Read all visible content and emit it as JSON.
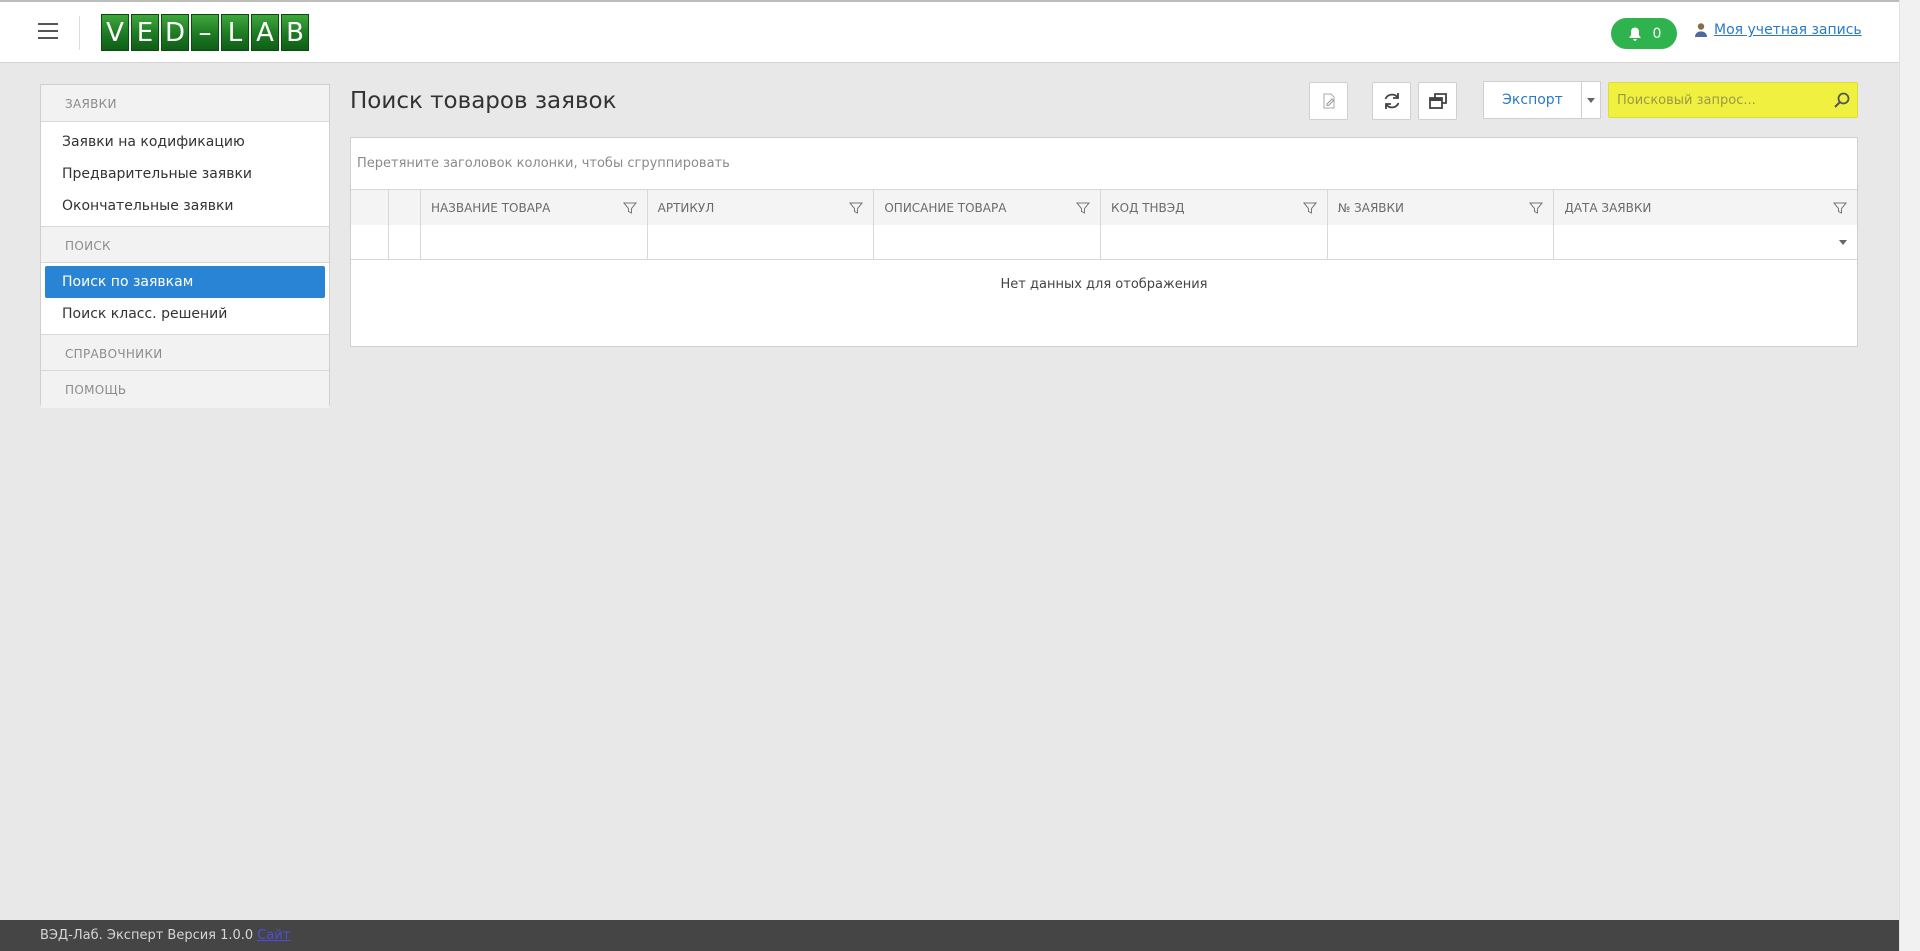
{
  "header": {
    "logo_letters": [
      "V",
      "E",
      "D",
      "–",
      "L",
      "A",
      "B"
    ],
    "notifications_count": "0",
    "account_label": "Моя учетная запись"
  },
  "sidebar": {
    "sections": [
      {
        "title": "ЗАЯВКИ",
        "items": [
          {
            "label": "Заявки на кодификацию",
            "active": false
          },
          {
            "label": "Предварительные заявки",
            "active": false
          },
          {
            "label": "Окончательные заявки",
            "active": false
          }
        ]
      },
      {
        "title": "ПОИСК",
        "items": [
          {
            "label": "Поиск по заявкам",
            "active": true
          },
          {
            "label": "Поиск класс. решений",
            "active": false
          }
        ]
      },
      {
        "title": "СПРАВОЧНИКИ",
        "items": []
      },
      {
        "title": "ПОМОЩЬ",
        "items": []
      }
    ]
  },
  "main": {
    "title": "Поиск товаров заявок",
    "toolbar": {
      "export_label": "Экспорт",
      "search_placeholder": "Поисковый запрос..."
    },
    "grid": {
      "group_panel_text": "Перетяните заголовок колонки, чтобы сгруппировать",
      "columns": [
        "НАЗВАНИЕ ТОВАРА",
        "АРТИКУЛ",
        "ОПИСАНИЕ ТОВАРА",
        "КОД ТНВЭД",
        "№ ЗАЯВКИ",
        "ДАТА ЗАЯВКИ"
      ],
      "empty_text": "Нет данных для отображения"
    }
  },
  "footer": {
    "text": "ВЭД-Лаб. Эксперт Версия 1.0.0",
    "link": "Сайт"
  },
  "colors": {
    "accent": "#2a84d6",
    "notification": "#2fb34e",
    "search_highlight": "#f0f040",
    "logo_green": "#1c7a22"
  }
}
